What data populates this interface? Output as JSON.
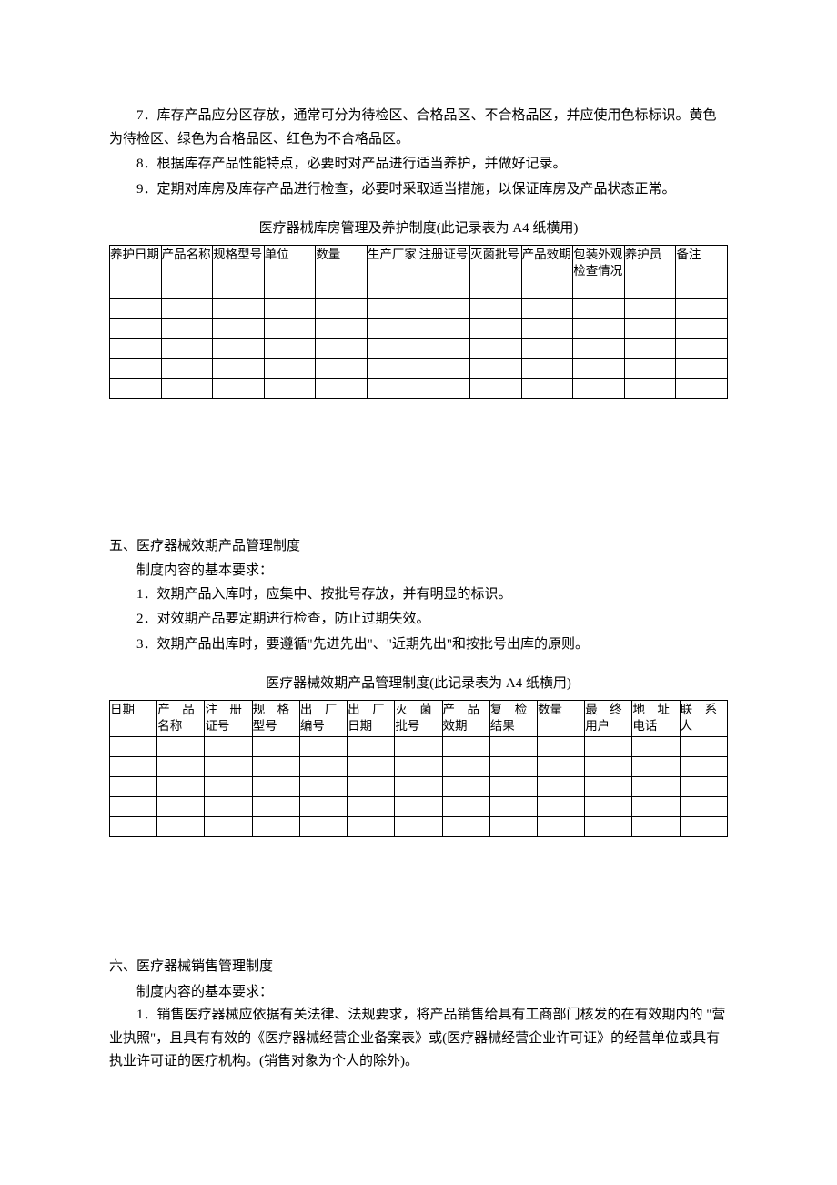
{
  "p7": "7．库存产品应分区存放，通常可分为待检区、合格品区、不合格品区，并应使用色标标识。黄色为待检区、绿色为合格品区、红色为不合格品区。",
  "p8": "8．根据库存产品性能特点，必要时对产品进行适当养护，并做好记录。",
  "p9": "9．定期对库房及库存产品进行检查，必要时采取适当措施，以保证库房及产品状态正常。",
  "table1_caption": "医疗器械库房管理及养护制度(此记录表为 A4 纸横用)",
  "table1_headers": [
    "养护日期",
    "产品名称",
    "规格型号",
    "单位",
    "数量",
    "生产厂家",
    "注册证号",
    "灭菌批号",
    "产品效期",
    "包装外观检查情况",
    "养护员",
    "备注"
  ],
  "section5_title": "五、医疗器械效期产品管理制度",
  "section5_req": "制度内容的基本要求：",
  "section5_p1": "1．效期产品入库时，应集中、按批号存放，并有明显的标识。",
  "section5_p2": "2．对效期产品要定期进行检查，防止过期失效。",
  "section5_p3": "3．效期产品出库时，要遵循\"先进先出\"、\"近期先出\"和按批号出库的原则。",
  "table2_caption": "医疗器械效期产品管理制度(此记录表为 A4 纸横用)",
  "table2_headers": [
    "日期",
    "产　品名称",
    "注　册证号",
    "规　格型号",
    "出　厂编号",
    "出　厂日期",
    "灭　菌批号",
    "产　品效期",
    "复　检结果",
    "数量",
    "最　终用户",
    "地　址电话",
    "联　系人"
  ],
  "section6_title": "六、医疗器械销售管理制度",
  "section6_req": "制度内容的基本要求：",
  "section6_p1": "1．销售医疗器械应依据有关法律、法规要求，将产品销售给具有工商部门核发的在有效期内的 \"营业执照\"，且具有有效的《医疗器械经营企业备案表》或(医疗器械经营企业许可证》的经营单位或具有执业许可证的医疗机构。(销售对象为个人的除外)。"
}
